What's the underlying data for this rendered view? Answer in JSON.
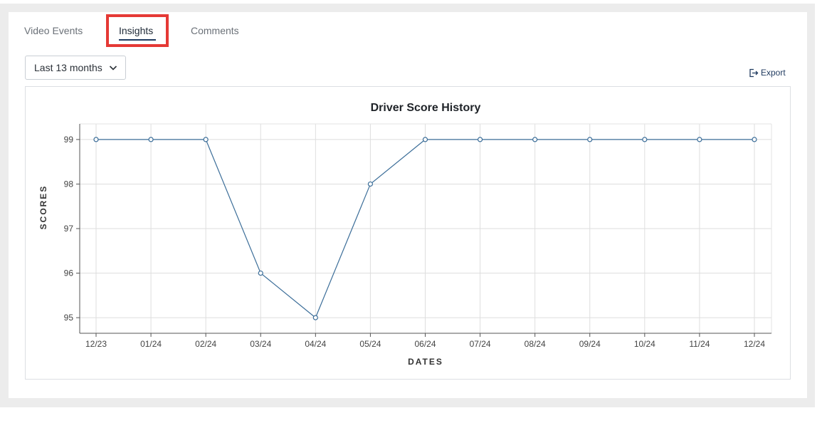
{
  "tabs": [
    {
      "label": "Video Events",
      "active": false
    },
    {
      "label": "Insights",
      "active": true
    },
    {
      "label": "Comments",
      "active": false
    }
  ],
  "range_select": {
    "value": "Last 13 months"
  },
  "export": {
    "label": "Export"
  },
  "colors": {
    "line": "#3c6e99",
    "highlight": "#e53935",
    "accent": "#1f3a5f"
  },
  "chart_data": {
    "type": "line",
    "title": "Driver Score History",
    "xlabel": "DATES",
    "ylabel": "SCORES",
    "categories": [
      "12/23",
      "01/24",
      "02/24",
      "03/24",
      "04/24",
      "05/24",
      "06/24",
      "07/24",
      "08/24",
      "09/24",
      "10/24",
      "11/24",
      "12/24"
    ],
    "series": [
      {
        "values": [
          99,
          99,
          99,
          96,
          95,
          98,
          99,
          99,
          99,
          99,
          99,
          99,
          99
        ]
      }
    ],
    "yticks": [
      95,
      96,
      97,
      98,
      99
    ],
    "ylim": [
      94.65,
      99.35
    ],
    "grid": true,
    "legend": "none"
  }
}
